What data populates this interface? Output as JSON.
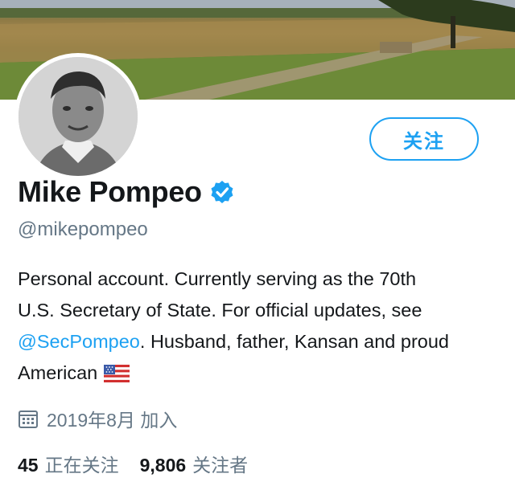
{
  "profile": {
    "name": "Mike Pompeo",
    "handle": "@mikepompeo",
    "bio": {
      "line1": "Personal account. Currently serving as the 70th",
      "line2": "U.S. Secretary of State. For official updates, see",
      "mention": "@SecPompeo",
      "line3_rest": ". Husband, father, Kansan and proud",
      "line4": "American"
    },
    "flag_icon": "us-flag-emoji",
    "joined": "2019年8月 加入"
  },
  "actions": {
    "follow_label": "关注"
  },
  "stats": {
    "following_count": "45",
    "following_label": "正在关注",
    "followers_count": "9,806",
    "followers_label": "关注者"
  },
  "colors": {
    "accent": "#1da1f2",
    "secondary_text": "#657786",
    "primary_text": "#14171a"
  }
}
